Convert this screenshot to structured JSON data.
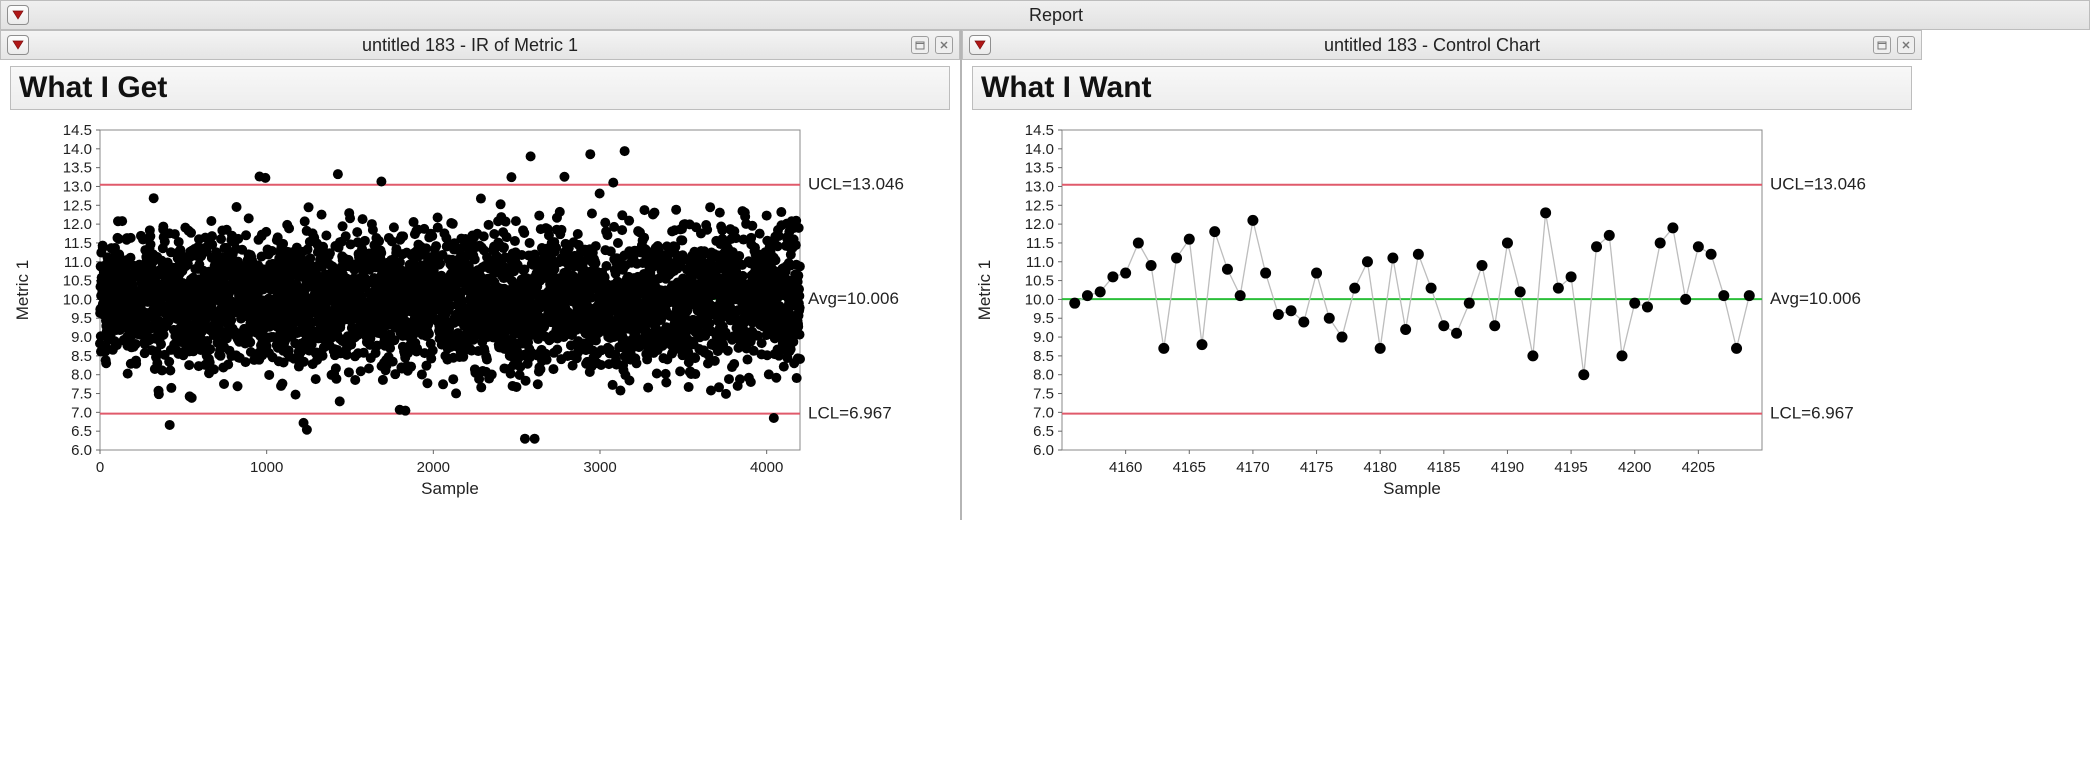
{
  "report": {
    "title": "Report"
  },
  "panes": {
    "left": {
      "title": "untitled 183 - IR of Metric 1",
      "section_title": "What I Get"
    },
    "right": {
      "title": "untitled 183 - Control Chart",
      "section_title": "What I Want"
    }
  },
  "chart_common": {
    "ylabel": "Metric 1",
    "xlabel": "Sample",
    "yticks": [
      6.0,
      6.5,
      7.0,
      7.5,
      8.0,
      8.5,
      9.0,
      9.5,
      10.0,
      10.5,
      11.0,
      11.5,
      12.0,
      12.5,
      13.0,
      13.5,
      14.0,
      14.5
    ],
    "ucl": 13.046,
    "avg": 10.006,
    "lcl": 6.967,
    "ucl_label": "UCL=13.046",
    "avg_label": "Avg=10.006",
    "lcl_label": "LCL=6.967"
  },
  "chart_data": [
    {
      "id": "left",
      "type": "scatter",
      "title": "",
      "xlabel": "Sample",
      "ylabel": "Metric 1",
      "xlim": [
        0,
        4200
      ],
      "ylim": [
        6.0,
        14.5
      ],
      "xticks": [
        0,
        1000,
        2000,
        3000,
        4000
      ],
      "yticks": [
        6.0,
        6.5,
        7.0,
        7.5,
        8.0,
        8.5,
        9.0,
        9.5,
        10.0,
        10.5,
        11.0,
        11.5,
        12.0,
        12.5,
        13.0,
        13.5,
        14.0,
        14.5
      ],
      "note": "dense scatter of ~4200 points centered near 10 with spread roughly 7–13; data points not individually readable",
      "n_points_approx": 4200,
      "reference_lines": {
        "ucl": 13.046,
        "avg": 10.006,
        "lcl": 6.967
      }
    },
    {
      "id": "right",
      "type": "line",
      "title": "",
      "xlabel": "Sample",
      "ylabel": "Metric 1",
      "xlim": [
        4155,
        4210
      ],
      "ylim": [
        6.0,
        14.5
      ],
      "xticks": [
        4160,
        4165,
        4170,
        4175,
        4180,
        4185,
        4190,
        4195,
        4200,
        4205
      ],
      "yticks": [
        6.0,
        6.5,
        7.0,
        7.5,
        8.0,
        8.5,
        9.0,
        9.5,
        10.0,
        10.5,
        11.0,
        11.5,
        12.0,
        12.5,
        13.0,
        13.5,
        14.0,
        14.5
      ],
      "reference_lines": {
        "ucl": 13.046,
        "avg": 10.006,
        "lcl": 6.967
      },
      "x": [
        4156,
        4157,
        4158,
        4159,
        4160,
        4161,
        4162,
        4163,
        4164,
        4165,
        4166,
        4167,
        4168,
        4169,
        4170,
        4171,
        4172,
        4173,
        4174,
        4175,
        4176,
        4177,
        4178,
        4179,
        4180,
        4181,
        4182,
        4183,
        4184,
        4185,
        4186,
        4187,
        4188,
        4189,
        4190,
        4191,
        4192,
        4193,
        4194,
        4195,
        4196,
        4197,
        4198,
        4199,
        4200,
        4201,
        4202,
        4203,
        4204,
        4205,
        4206,
        4207,
        4208,
        4209
      ],
      "y": [
        9.9,
        10.1,
        10.2,
        10.6,
        10.7,
        11.5,
        10.9,
        8.7,
        11.1,
        11.6,
        8.8,
        11.8,
        10.8,
        10.1,
        12.1,
        10.7,
        9.6,
        9.7,
        9.4,
        10.7,
        9.5,
        9.0,
        10.3,
        11.0,
        8.7,
        11.1,
        9.2,
        11.2,
        10.3,
        9.3,
        9.1,
        9.9,
        10.9,
        9.3,
        11.5,
        10.2,
        8.5,
        12.3,
        10.3,
        10.6,
        8.0,
        11.4,
        11.7,
        8.5,
        9.9,
        9.8,
        11.5,
        11.9,
        10.0,
        11.4,
        11.2,
        10.1,
        8.7,
        10.1
      ]
    }
  ]
}
